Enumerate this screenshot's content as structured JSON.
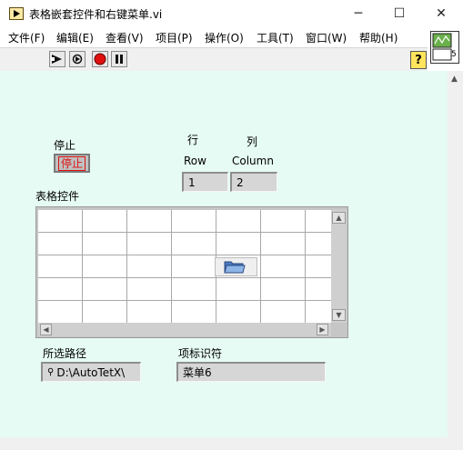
{
  "window": {
    "title": "表格嵌套控件和右键菜单.vi",
    "minimize_glyph": "─",
    "maximize_glyph": "☐",
    "close_glyph": "✕"
  },
  "menu": [
    "文件(F)",
    "编辑(E)",
    "查看(V)",
    "项目(P)",
    "操作(O)",
    "工具(T)",
    "窗口(W)",
    "帮助(H)"
  ],
  "toolbar": {
    "icons": [
      "run-arrow-icon",
      "run-continuously-icon",
      "abort-icon",
      "pause-icon"
    ],
    "help_glyph": "?",
    "connector_number": "5"
  },
  "panel": {
    "background": "#e6fbf3",
    "stop": {
      "label": "停止",
      "button_text": "停止"
    },
    "row": {
      "header": "行",
      "label": "Row",
      "value": "1"
    },
    "column": {
      "header": "列",
      "label": "Column",
      "value": "2"
    },
    "table": {
      "label": "表格控件",
      "columns": 7,
      "rows": 5
    },
    "path": {
      "label": "所选路径",
      "value": "D:\\AutoTetX\\"
    },
    "item": {
      "label": "项标识符",
      "value": "菜单6"
    }
  }
}
